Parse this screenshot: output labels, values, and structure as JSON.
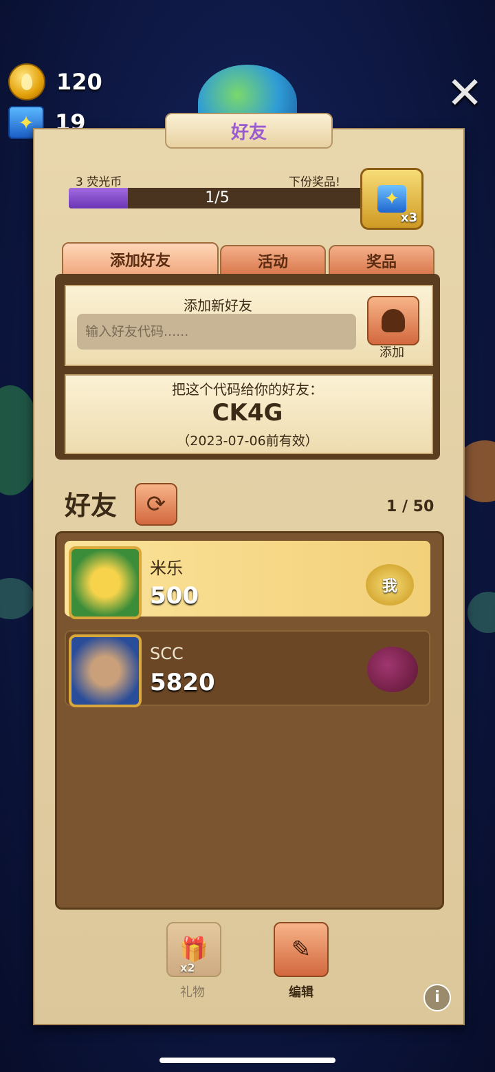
{
  "currency": {
    "coins": "120",
    "butterflies": "19"
  },
  "header": {
    "title": "好友"
  },
  "progress": {
    "left_label": "3 荧光币",
    "right_label": "下份奖品!",
    "value_text": "1/5",
    "fraction": 0.2,
    "reward_multiplier": "x3"
  },
  "tabs": [
    {
      "label": "添加好友"
    },
    {
      "label": "活动"
    },
    {
      "label": "奖品"
    }
  ],
  "add_friend": {
    "title": "添加新好友",
    "placeholder": "输入好友代码......",
    "button_label": "添加"
  },
  "share_code": {
    "title": "把这个代码给你的好友：",
    "code": "CK4G",
    "expiry": "（2023-07-06前有效）"
  },
  "friends": {
    "title": "好友",
    "count": "1 / 50",
    "list": [
      {
        "name": "米乐",
        "score": "500",
        "badge": "我"
      },
      {
        "name": "SCC",
        "score": "5820"
      }
    ]
  },
  "bottom": {
    "gift_label": "礼物",
    "gift_multiplier": "x2",
    "edit_label": "编辑"
  }
}
